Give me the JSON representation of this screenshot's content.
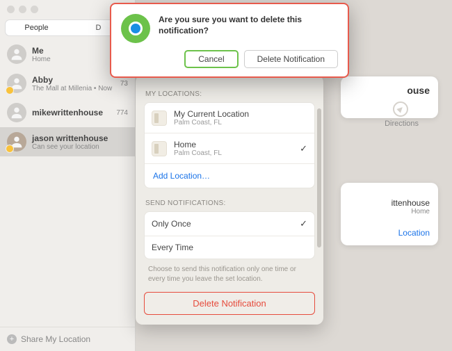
{
  "tabs": {
    "people": "People",
    "devices": "D"
  },
  "people": [
    {
      "name": "Me",
      "sub": "Home"
    },
    {
      "name": "Abby",
      "sub": "The Mall at Millenia • Now",
      "badge": true,
      "dist": "73"
    },
    {
      "name": "mikewrittenhouse",
      "sub": "",
      "dist": "774"
    },
    {
      "name": "jason writtenhouse",
      "sub": "Can see your location",
      "badge": true,
      "selected": true
    }
  ],
  "footer": {
    "share": "Share My Location"
  },
  "back": {
    "title": "ouse",
    "directions": "Directions",
    "contact_name": "ittenhouse",
    "contact_sub": "Home",
    "add_link": "Location"
  },
  "popover": {
    "locations_label": "MY LOCATIONS:",
    "locations": [
      {
        "title": "My Current Location",
        "sub": "Palm Coast, FL",
        "checked": false
      },
      {
        "title": "Home",
        "sub": "Palm Coast, FL",
        "checked": true
      }
    ],
    "add_location": "Add Location…",
    "send_label": "SEND NOTIFICATIONS:",
    "options": [
      {
        "title": "Only Once",
        "checked": true
      },
      {
        "title": "Every Time",
        "checked": false
      }
    ],
    "help": "Choose to send this notification only one time or every time you leave the set location.",
    "delete": "Delete Notification"
  },
  "dialog": {
    "message": "Are you sure you want to delete this notification?",
    "cancel": "Cancel",
    "delete": "Delete Notification"
  }
}
